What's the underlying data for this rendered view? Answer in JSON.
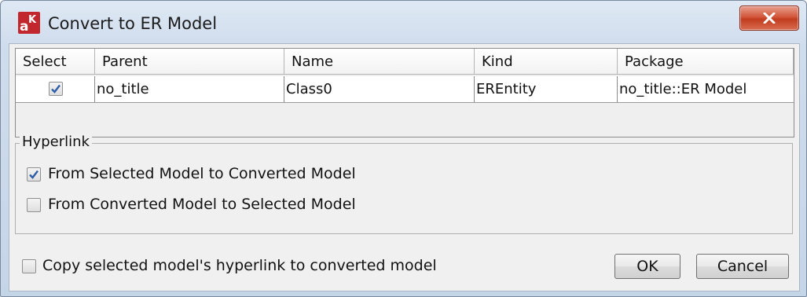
{
  "window": {
    "title": "Convert to ER Model"
  },
  "table": {
    "headers": [
      "Select",
      "Parent",
      "Name",
      "Kind",
      "Package"
    ],
    "rows": [
      {
        "selected": true,
        "parent": "no_title",
        "name": "Class0",
        "kind": "EREntity",
        "package": "no_title::ER Model"
      }
    ]
  },
  "hyperlink": {
    "legend": "Hyperlink",
    "options": [
      {
        "label": "From Selected Model to Converted Model",
        "checked": true
      },
      {
        "label": "From Converted Model to Selected Model",
        "checked": false
      }
    ]
  },
  "footer": {
    "copy_label": "Copy selected model's hyperlink to converted model",
    "copy_checked": false,
    "ok_label": "OK",
    "cancel_label": "Cancel"
  },
  "colors": {
    "check": "#2f5ea8",
    "close_button": "#c9452a"
  }
}
